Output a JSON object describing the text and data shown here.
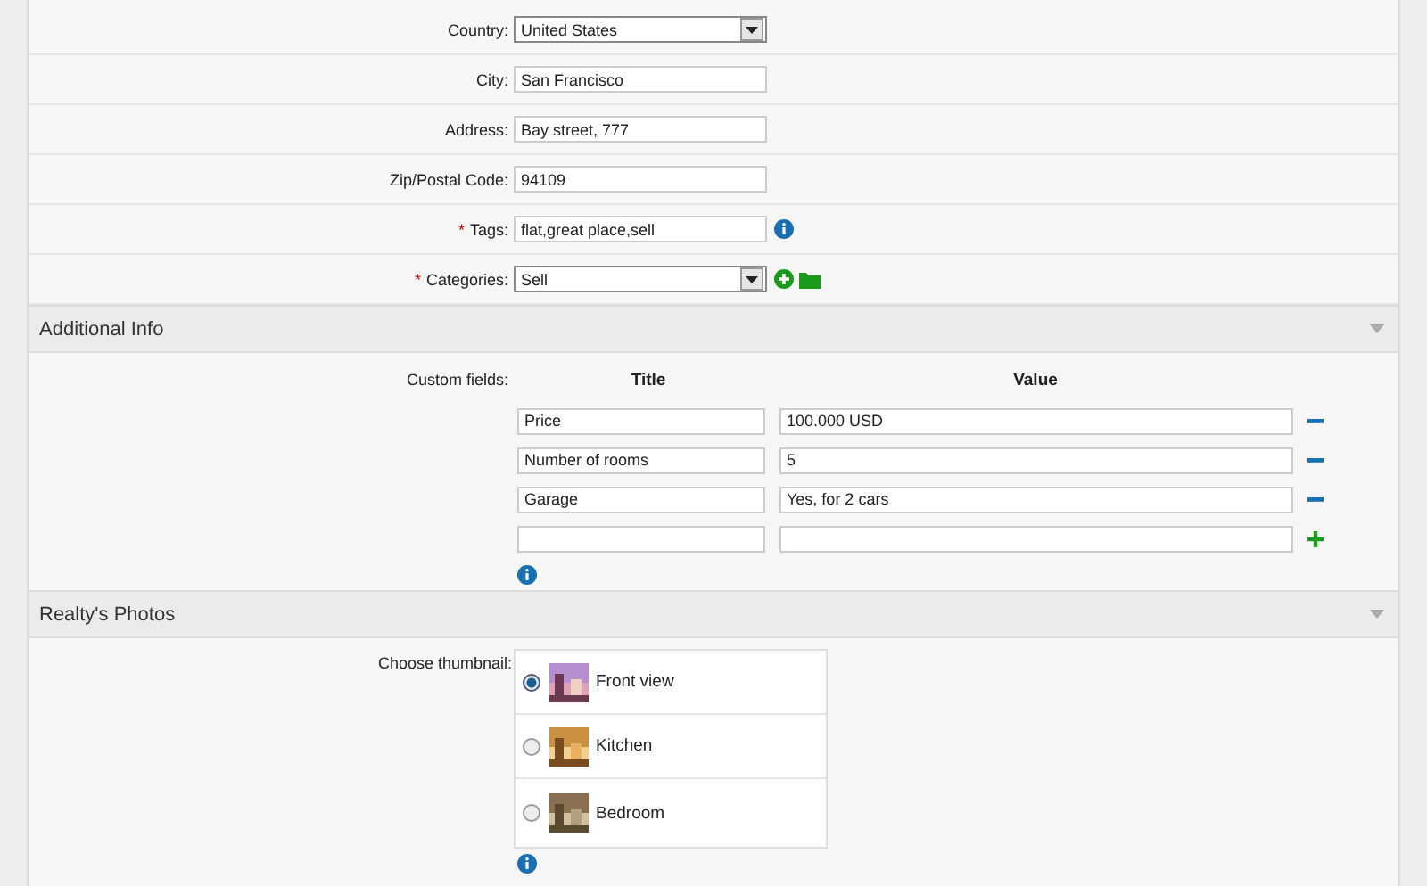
{
  "fields": [
    {
      "label": "Country:",
      "kind": "select",
      "value": "United States",
      "required": false
    },
    {
      "label": "City:",
      "kind": "text",
      "value": "San Francisco",
      "required": false
    },
    {
      "label": "Address:",
      "kind": "text",
      "value": "Bay street, 777",
      "required": false
    },
    {
      "label": "Zip/Postal Code:",
      "kind": "text",
      "value": "94109",
      "required": false
    },
    {
      "label": "Tags:",
      "kind": "text",
      "value": "flat,great place,sell",
      "required": true,
      "info": true
    },
    {
      "label": "Categories:",
      "kind": "select",
      "value": "Sell",
      "required": true,
      "add": true
    }
  ],
  "required_mark": "*",
  "additional_info": {
    "title": "Additional Info",
    "label": "Custom fields:",
    "columns": [
      "Title",
      "Value"
    ],
    "rows": [
      {
        "title": "Price",
        "value": "100.000 USD",
        "kind": "remove"
      },
      {
        "title": "Number of rooms",
        "value": "5",
        "kind": "remove"
      },
      {
        "title": "Garage",
        "value": "Yes, for 2 cars",
        "kind": "remove"
      },
      {
        "kind": "add"
      }
    ]
  },
  "photos": {
    "title": "Realty's Photos",
    "label": "Choose thumbnail:",
    "items": [
      {
        "label": "Front view",
        "selected": true
      },
      {
        "label": "Kitchen",
        "selected": false
      },
      {
        "label": "Bedroom",
        "selected": false
      }
    ]
  }
}
